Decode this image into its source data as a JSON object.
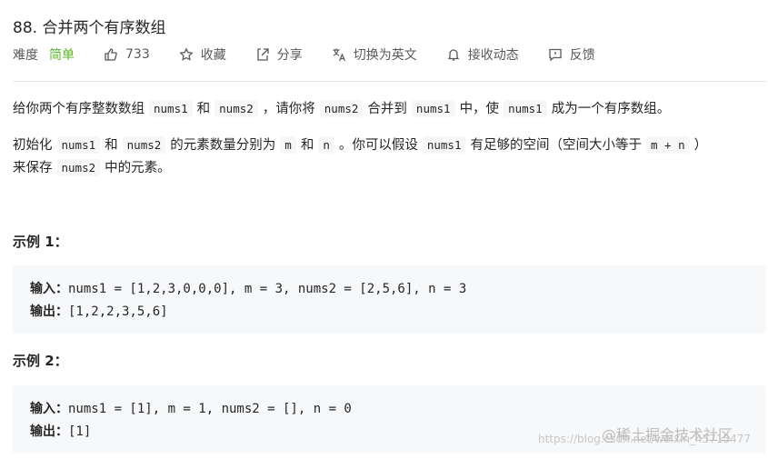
{
  "problem": {
    "title": "88. 合并两个有序数组"
  },
  "meta": {
    "difficulty_label": "难度",
    "difficulty": "简单",
    "likes": "733",
    "favorite": "收藏",
    "share": "分享",
    "switch_lang": "切换为英文",
    "notify": "接收动态",
    "feedback": "反馈",
    "colors": {
      "easy": "#5ab726",
      "text": "#595959"
    }
  },
  "description": {
    "p1": [
      "给你两个有序整数数组",
      "nums1",
      "和",
      "nums2",
      "，请你将",
      "nums2",
      "合并到",
      "nums1",
      "中，使",
      "nums1",
      "成为一个有序数组。"
    ],
    "p2": [
      "初始化",
      "nums1",
      "和",
      "nums2",
      "的元素数量分别为",
      "m",
      "和",
      "n",
      "。你可以假设",
      "nums1",
      "有足够的空间（空间大小等于",
      "m + n",
      "）"
    ],
    "p3": [
      "来保存",
      "nums2",
      "中的元素。"
    ]
  },
  "examples": [
    {
      "title": "示例 1：",
      "input_label": "输入：",
      "input": "nums1 = [1,2,3,0,0,0], m = 3, nums2 = [2,5,6], n = 3",
      "output_label": "输出：",
      "output": "[1,2,2,3,5,6]"
    },
    {
      "title": "示例 2：",
      "input_label": "输入：",
      "input": "nums1 = [1], m = 1, nums2 = [], n = 0",
      "output_label": "输出：",
      "output": "[1]"
    }
  ],
  "watermark": {
    "url": "https://blog.csdn.net/weixin_45715477",
    "badge": "@稀土掘金技术社区"
  }
}
